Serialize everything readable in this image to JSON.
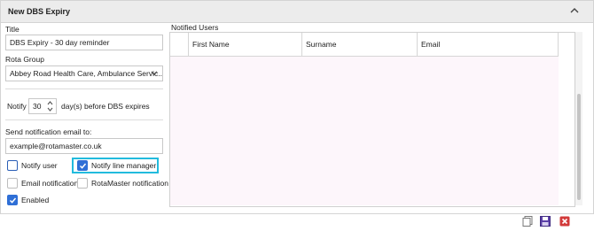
{
  "header": {
    "title": "New DBS Expiry"
  },
  "form": {
    "title_label": "Title",
    "title_value": "DBS Expiry - 30 day reminder",
    "rota_group_label": "Rota Group",
    "rota_group_value": "Abbey Road Health Care, Ambulance Servic...",
    "notify_label": "Notify",
    "notify_days": "30",
    "notify_suffix": "day(s) before DBS expires",
    "email_label": "Send notification email to:",
    "email_value": "example@rotamaster.co.uk"
  },
  "options": {
    "notify_user": {
      "label": "Notify user",
      "checked": false
    },
    "notify_line_manager": {
      "label": "Notify line manager",
      "checked": true
    },
    "email_notification": {
      "label": "Email notification",
      "checked": false
    },
    "rotamaster_notification": {
      "label": "RotaMaster notification",
      "checked": false
    },
    "enabled": {
      "label": "Enabled",
      "checked": true
    }
  },
  "notified_users": {
    "title": "Notified Users",
    "columns": [
      "First Name",
      "Surname",
      "Email"
    ],
    "rows": []
  },
  "toolbar": {
    "icons": [
      "copy-icon",
      "save-icon",
      "delete-icon"
    ]
  },
  "colors": {
    "accent": "#2f6fd6",
    "highlight": "#22bbdd",
    "delete": "#d23a3a"
  }
}
